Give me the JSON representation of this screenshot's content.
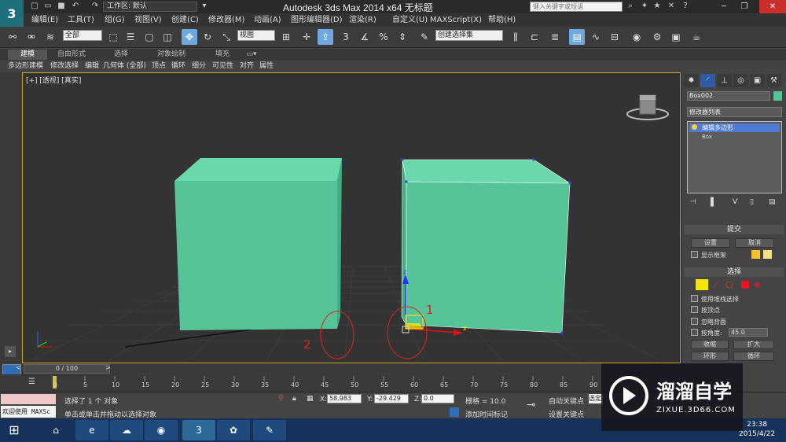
{
  "titlebar": {
    "workspace": "工作区: 默认",
    "app_title": "Autodesk 3ds Max  2014 x64      无标题",
    "search_placeholder": "键入关键字或短语",
    "quick_access_icons": [
      "new-icon",
      "open-icon",
      "save-icon",
      "undo-icon",
      "redo-icon",
      "project-icon"
    ]
  },
  "menu": {
    "items": [
      "编辑(E)",
      "工具(T)",
      "组(G)",
      "视图(V)",
      "创建(C)",
      "修改器(M)",
      "动画(A)",
      "图形编辑器(D)",
      "渲染(R)",
      "自定义(U)",
      "MAXScript(X)",
      "帮助(H)"
    ]
  },
  "toolbar": {
    "selection_filter": "全部",
    "ref_coord": "视图",
    "named_selection": "创建选择集",
    "snap_label": "3",
    "percent_label": "%"
  },
  "ribbon": {
    "tabs": [
      "建模",
      "自由形式",
      "选择",
      "对象绘制",
      "填充"
    ],
    "sub_items": [
      "多边形建模",
      "修改选择",
      "编辑",
      "几何体 (全部)",
      "顶点",
      "循环",
      "细分",
      "可见性",
      "对齐",
      "属性"
    ]
  },
  "viewport": {
    "label": "[+] [透视] [真实]",
    "annotation_1": "1",
    "annotation_2": "2",
    "box_color": "#57c498",
    "frame_color": "#c8a42a",
    "axis_x": "x",
    "axis_z": "z"
  },
  "command_panel": {
    "object_name": "Box002",
    "object_color": "#57c498",
    "modifier_list": "修改器列表",
    "stack_selected": "编辑多边形",
    "stack_base": "Box",
    "soft_head": "提交",
    "btn_settings": "设置",
    "btn_cancel": "取消",
    "show_cage": "显示框架",
    "selection_head": "选择",
    "use_stack": "使用堆栈选择",
    "by_vertex": "按顶点",
    "ignore_backface": "忽略背面",
    "by_angle": "按角度:",
    "angle_value": "45.0",
    "shrink": "收缩",
    "grow": "扩大",
    "ring": "环形",
    "loop": "循环",
    "select_partial": "选择"
  },
  "timeline": {
    "slider_text": "0 / 100",
    "ticks": [
      "0",
      "5",
      "10",
      "15",
      "20",
      "25",
      "30",
      "35",
      "40",
      "45",
      "50",
      "55",
      "60",
      "65",
      "70",
      "75",
      "80",
      "85",
      "90"
    ]
  },
  "status": {
    "maxscript_text": "欢迎使用 MAXSc",
    "selected_text": "选择了 1 个 对象",
    "prompt_text": "单击或单击并拖动以选择对象",
    "x_label": "X:",
    "x_value": "58.983",
    "y_label": "Y:",
    "y_value": "-29.429",
    "z_label": "Z:",
    "z_value": "0.0",
    "grid_text": "栅格 = 10.0",
    "add_time_tag": "添加时间标记",
    "auto_key": "自动关键点",
    "set_key": "设置关键点",
    "selected_btn": "选定"
  },
  "taskbar": {
    "apps": [
      "windows-icon",
      "home-icon",
      "ie-icon",
      "network-icon",
      "game-icon",
      "3dsmax-icon",
      "paint-icon",
      "palette-icon"
    ],
    "time": "23:38",
    "date": "2015/4/22"
  },
  "watermark": {
    "title": "溜溜自学",
    "subtitle": "ZIXUE.3D66.COM"
  }
}
